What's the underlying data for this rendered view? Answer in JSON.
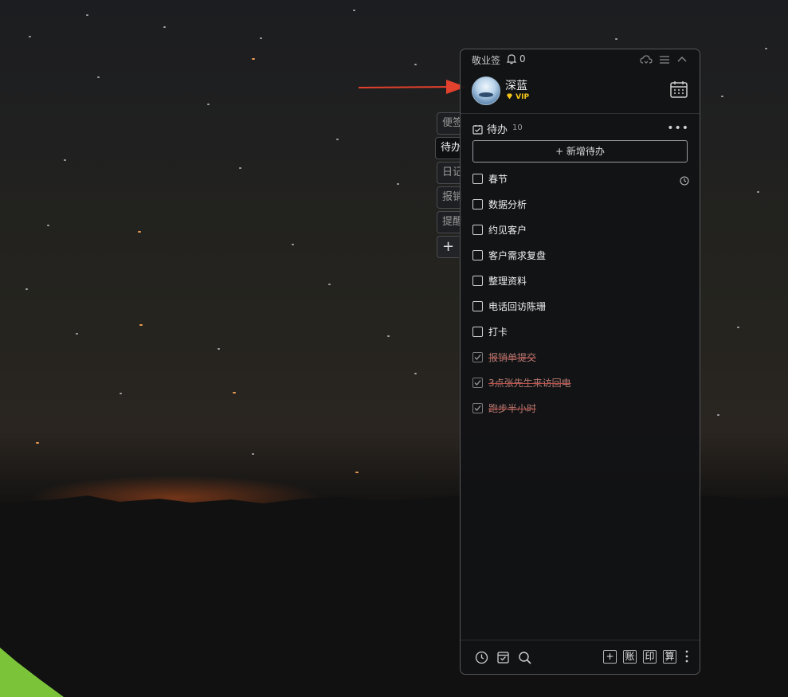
{
  "app": {
    "name": "敬业签",
    "notification_count": "0"
  },
  "user": {
    "name": "深蓝",
    "badge": "VIP"
  },
  "side_tabs": [
    {
      "label": "便签",
      "active": false
    },
    {
      "label": "待办",
      "active": true
    },
    {
      "label": "日记",
      "active": false
    },
    {
      "label": "报销",
      "active": false
    },
    {
      "label": "提醒",
      "active": false
    },
    {
      "label": "+",
      "active": false
    }
  ],
  "section": {
    "title": "待办",
    "count": "10",
    "more": "•••"
  },
  "new_todo_label": "+ 新增待办",
  "todos": [
    {
      "text": "春节",
      "done": false,
      "has_reminder": true
    },
    {
      "text": "数据分析",
      "done": false
    },
    {
      "text": "约见客户",
      "done": false
    },
    {
      "text": "客户需求复盘",
      "done": false
    },
    {
      "text": "整理资料",
      "done": false
    },
    {
      "text": "电话回访陈珊",
      "done": false
    },
    {
      "text": "打卡",
      "done": false
    },
    {
      "text": "报销单提交",
      "done": true
    },
    {
      "text": "3点张先生来访回电",
      "done": true
    },
    {
      "text": "跑步半小时",
      "done": true
    }
  ],
  "bottom_buttons": [
    "+",
    "账",
    "印",
    "算"
  ],
  "icons": {
    "bell": "bell-icon",
    "cloud": "cloud-sync-icon",
    "menu": "menu-icon",
    "collapse": "chevron-up-icon",
    "calendar": "calendar-icon",
    "history": "clock-icon",
    "archive": "archive-icon",
    "search": "search-icon"
  },
  "colors": {
    "vip": "#f5c518",
    "done_text": "#b87a73",
    "strike": "#c0504a",
    "arrow": "#e2412d"
  }
}
